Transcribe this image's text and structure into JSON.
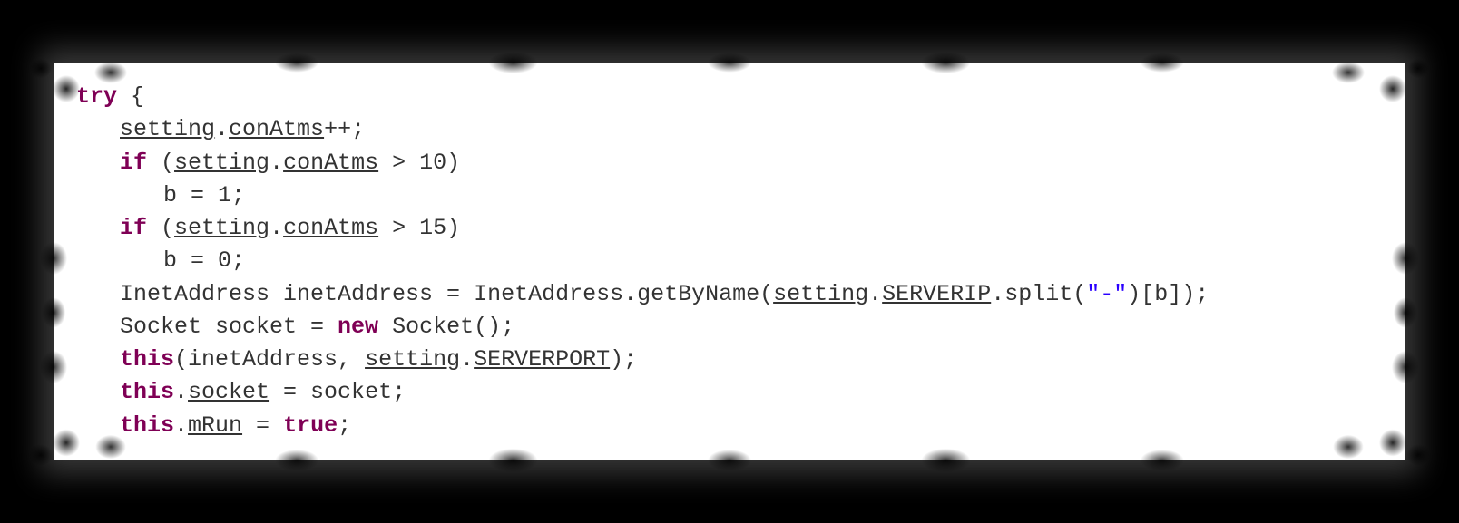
{
  "code": {
    "line1": {
      "keyword": "try",
      "rest": " {"
    },
    "line2": {
      "part1": "setting",
      "part2": ".",
      "part3": "conAtms",
      "part4": "++;"
    },
    "line3": {
      "keyword": "if",
      "paren": " (",
      "part1": "setting",
      "part2": ".",
      "part3": "conAtms",
      "rest": " > 10)"
    },
    "line4": {
      "text": "b = 1;"
    },
    "line5": {
      "keyword": "if",
      "paren": " (",
      "part1": "setting",
      "part2": ".",
      "part3": "conAtms",
      "rest": " > 15)"
    },
    "line6": {
      "text": "b = 0;"
    },
    "line7": {
      "pre": "InetAddress inetAddress = InetAddress.getByName(",
      "part1": "setting",
      "part2": ".",
      "part3": "SERVERIP",
      "mid": ".split(",
      "str": "\"-\"",
      "post": ")[b]);"
    },
    "line8": {
      "pre": "Socket socket = ",
      "keyword": "new",
      "post": " Socket();"
    },
    "line9": {
      "keyword": "this",
      "mid": "(inetAddress, ",
      "part1": "setting",
      "part2": ".",
      "part3": "SERVERPORT",
      "post": ");"
    },
    "line10": {
      "keyword": "this",
      "mid": ".",
      "part1": "socket",
      "post": " = socket;"
    },
    "line11": {
      "keyword": "this",
      "mid": ".",
      "part1": "mRun",
      "post": " = ",
      "keyword2": "true",
      "semi": ";"
    }
  }
}
